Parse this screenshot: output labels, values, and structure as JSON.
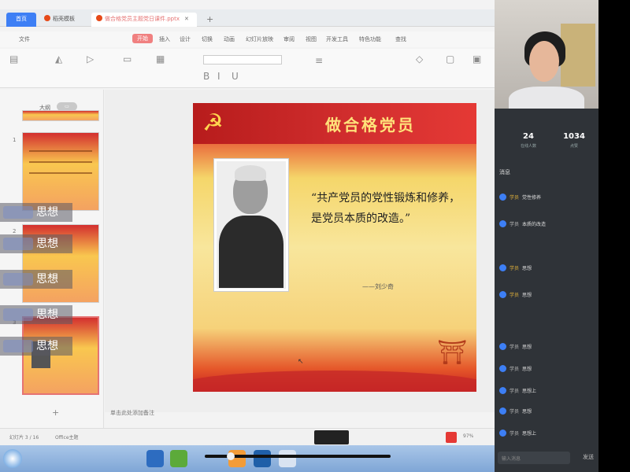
{
  "browser": {
    "tabs": [
      {
        "label": "首页"
      },
      {
        "label": "稻壳模板"
      },
      {
        "label": "做合格党员主题党日课件.pptx"
      }
    ]
  },
  "menu": [
    "文件",
    "开始",
    "插入",
    "设计",
    "切换",
    "动画",
    "幻灯片放映",
    "审阅",
    "视图",
    "开发工具",
    "特色功能",
    "查找"
  ],
  "slide_title": "做合格党员",
  "quote": "“共产党员的党性锻炼和修养，是党员本质的改造。”",
  "author": "——刘少奇",
  "overlay_chats": [
    {
      "text": "思想"
    },
    {
      "text": "思想"
    },
    {
      "text": "思想"
    },
    {
      "text": "思想"
    },
    {
      "text": "思想"
    }
  ],
  "thumbpane": {
    "outline_tab": "大纲",
    "slide_numbers": [
      "1",
      "2",
      "3"
    ]
  },
  "notes_placeholder": "单击此处添加备注",
  "status": {
    "slide_info": "幻灯片 3 / 16",
    "theme": "Office主题",
    "zoom": "97%"
  },
  "live": {
    "viewers": "24",
    "viewers_label": "在线人数",
    "likes": "1034",
    "likes_label": "点赞",
    "chat_header": "消息",
    "messages": [
      {
        "name": "学员",
        "text": "党性修养"
      },
      {
        "name": "学员",
        "text": "本质的改造"
      },
      {
        "name": "学员",
        "text": "思想"
      },
      {
        "name": "学员",
        "text": "思想"
      },
      {
        "name": "学员",
        "text": "思想"
      },
      {
        "name": "学员",
        "text": "思想"
      },
      {
        "name": "学员",
        "text": "思想上"
      },
      {
        "name": "学员",
        "text": "思想"
      },
      {
        "name": "学员",
        "text": "思想上"
      }
    ],
    "input_placeholder": "输入消息",
    "send_label": "发送"
  }
}
